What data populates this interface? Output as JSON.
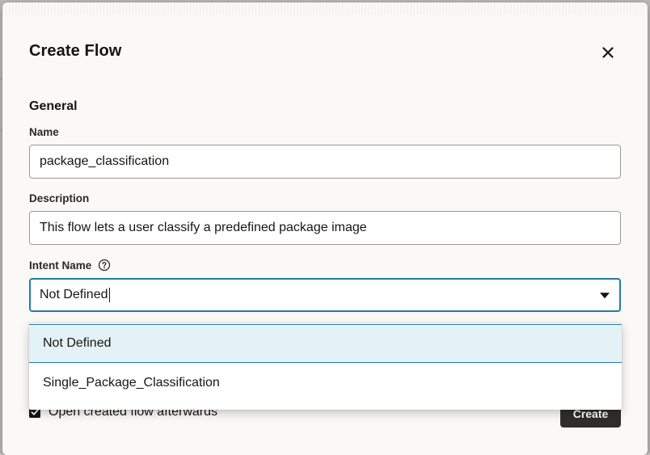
{
  "dialog": {
    "title": "Create Flow",
    "close_icon": "close-icon"
  },
  "general": {
    "heading": "General"
  },
  "name_field": {
    "label": "Name",
    "value": "package_classification"
  },
  "description_field": {
    "label": "Description",
    "value": "This flow lets a user classify a predefined package image"
  },
  "intent_field": {
    "label": "Intent Name",
    "help_icon": "help-icon",
    "value": "Not Defined",
    "dropdown_icon": "chevron-down-icon",
    "options": [
      {
        "label": "Not Defined",
        "selected": true
      },
      {
        "label": "Single_Package_Classification",
        "selected": false
      }
    ]
  },
  "footer": {
    "checkbox_label": "Open created flow afterwards",
    "checkbox_checked": true,
    "create_label": "Create"
  },
  "colors": {
    "focus_border": "#227e9e",
    "selected_option_bg": "#e4f1f7",
    "primary_button_bg": "#312d2a"
  }
}
